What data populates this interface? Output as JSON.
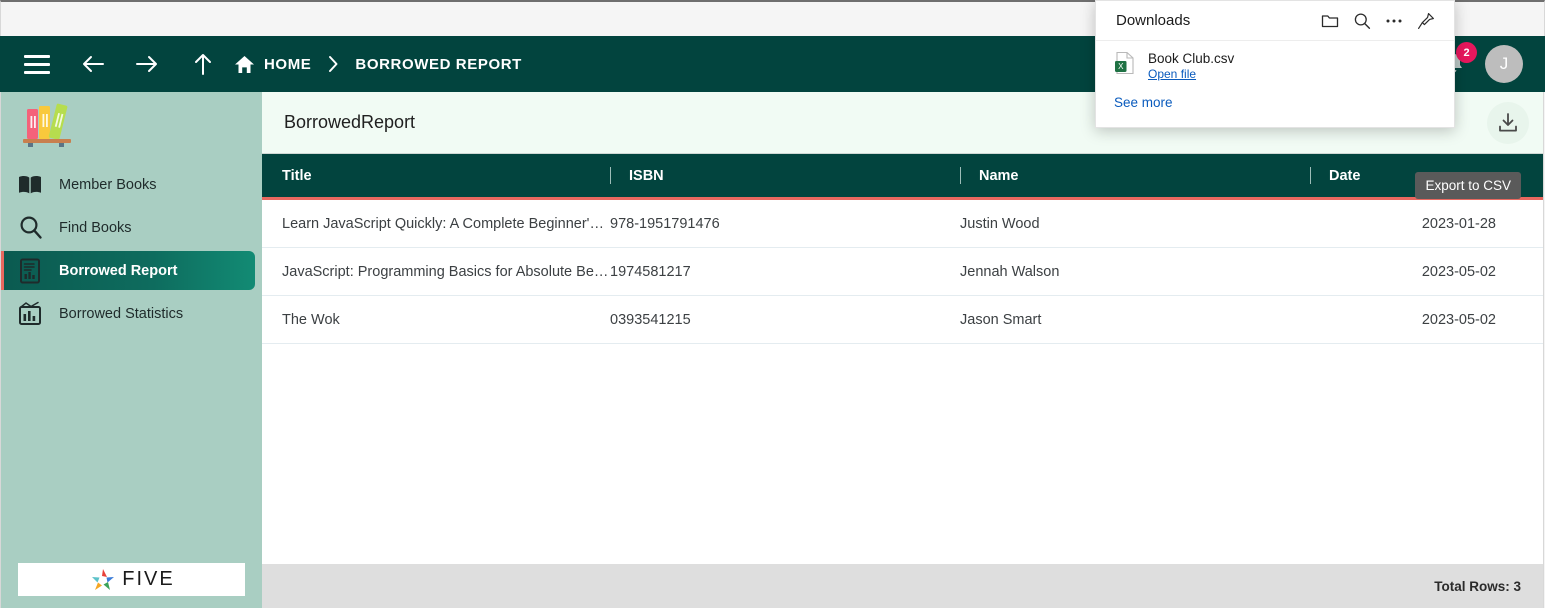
{
  "header": {
    "menu_icon": "hamburger-icon",
    "back_icon": "arrow-left-icon",
    "forward_icon": "arrow-right-icon",
    "up_icon": "arrow-up-icon",
    "home_icon": "home-icon",
    "home_label": "HOME",
    "separator_icon": "chevron-right-icon",
    "current_crumb": "BORROWED REPORT",
    "bell_icon": "bell-icon",
    "notification_count": "2",
    "avatar_initial": "J",
    "accent_teal": "#02443E"
  },
  "sidebar": {
    "logo_icon": "books-shelf-logo",
    "items": [
      {
        "label": "Member Books",
        "icon": "open-book-icon",
        "active": false
      },
      {
        "label": "Find Books",
        "icon": "magnifier-icon",
        "active": false
      },
      {
        "label": "Borrowed Report",
        "icon": "report-document-icon",
        "active": true
      },
      {
        "label": "Borrowed Statistics",
        "icon": "bar-chart-icon",
        "active": false
      }
    ],
    "footer_logo_text": "FIVE",
    "footer_logo_icon": "five-pinwheel-logo",
    "background": "#a9cec2",
    "active_accent": "#e8685f"
  },
  "panel": {
    "title": "BorrowedReport",
    "export_icon": "download-tray-icon",
    "export_tooltip": "Export to CSV"
  },
  "table": {
    "columns": [
      "Title",
      "ISBN",
      "Name",
      "Date"
    ],
    "rows": [
      {
        "title": "Learn JavaScript Quickly: A Complete Beginner's…",
        "isbn": "978-1951791476",
        "name": "Justin Wood",
        "date": "2023-01-28"
      },
      {
        "title": "JavaScript: Programming Basics for Absolute Be…",
        "isbn": "1974581217",
        "name": "Jennah Walson",
        "date": "2023-05-02"
      },
      {
        "title": "The Wok",
        "isbn": "0393541215",
        "name": "Jason Smart",
        "date": "2023-05-02"
      }
    ],
    "header_accent": "#e8685f"
  },
  "status": {
    "total_rows": "Total Rows: 3"
  },
  "downloads_popup": {
    "title": "Downloads",
    "folder_icon": "folder-icon",
    "search_icon": "search-icon",
    "more_icon": "ellipsis-icon",
    "pin_icon": "pin-icon",
    "file_icon": "csv-file-icon",
    "file_name": "Book Club.csv",
    "open_file_label": "Open file",
    "see_more_label": "See more"
  }
}
